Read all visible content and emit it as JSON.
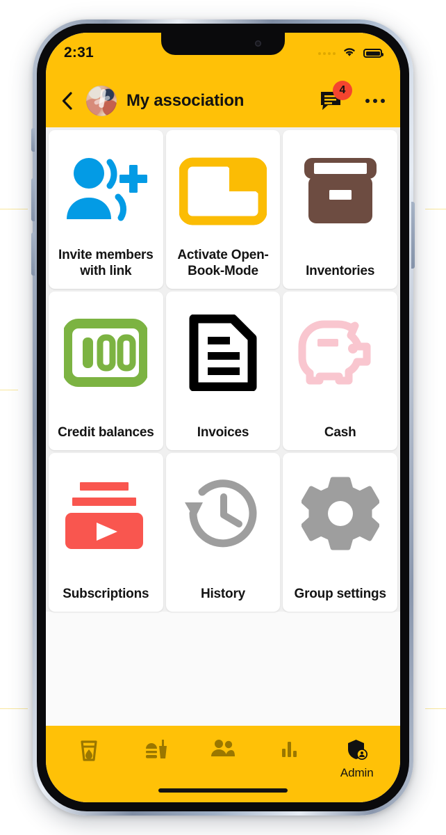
{
  "status_bar": {
    "time": "2:31",
    "cellular_icon": "cellular-dots-icon",
    "wifi_icon": "wifi-icon",
    "battery_icon": "battery-full-icon"
  },
  "app_bar": {
    "back_icon": "back-chevron-icon",
    "avatar_icon": "group-avatar-photo",
    "title": "My association",
    "messages_icon": "chat-bubble-icon",
    "messages_badge": "4",
    "overflow_icon": "more-options-icon"
  },
  "grid": {
    "tiles": [
      {
        "label": "Invite members with link",
        "icon": "person-add-icon",
        "color": "#039BE5"
      },
      {
        "label": "Activate Open-Book-Mode",
        "icon": "folder-open-icon",
        "color": "#FBBC04"
      },
      {
        "label": "Inventories",
        "icon": "archive-box-icon",
        "color": "#6D4C41"
      },
      {
        "label": "Credit balances",
        "icon": "banknote-100-icon",
        "color": "#7CB342"
      },
      {
        "label": "Invoices",
        "icon": "document-lines-icon",
        "color": "#000000"
      },
      {
        "label": "Cash",
        "icon": "piggy-bank-icon",
        "color": "#F9C6CF"
      },
      {
        "label": "Subscriptions",
        "icon": "subscriptions-icon",
        "color": "#F9564F"
      },
      {
        "label": "History",
        "icon": "history-clock-icon",
        "color": "#9E9E9E"
      },
      {
        "label": "Group settings",
        "icon": "gear-icon",
        "color": "#9E9E9E"
      }
    ]
  },
  "bottom_nav": {
    "items": [
      {
        "label": "",
        "icon": "drink-cup-icon",
        "active": false
      },
      {
        "label": "",
        "icon": "fast-food-icon",
        "active": false
      },
      {
        "label": "",
        "icon": "people-icon",
        "active": false
      },
      {
        "label": "",
        "icon": "bar-chart-icon",
        "active": false
      },
      {
        "label": "Admin",
        "icon": "admin-shield-icon",
        "active": true
      }
    ]
  },
  "theme": {
    "accent_yellow": "#FFC107",
    "badge_red": "#F4452F",
    "screen_background": "#FAFAFA",
    "tile_background": "#FFFFFF",
    "nav_inactive": "#9A7700",
    "nav_active": "#111111"
  }
}
